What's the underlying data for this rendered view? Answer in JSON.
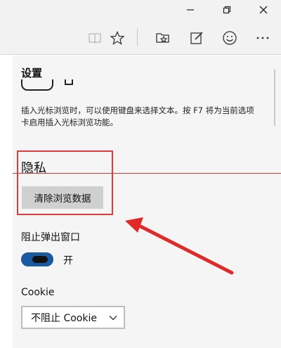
{
  "settings": {
    "title": "设置",
    "caret_browsing_desc": "插入光标浏览时，可以使用键盘来选择文本。按 F7 将为当前选项卡启用插入光标浏览功能。",
    "privacy_heading": "隐私",
    "clear_button_label": "清除浏览数据",
    "popup_label": "阻止弹出窗口",
    "popup_state": "开",
    "cookie_label": "Cookie",
    "cookie_value": "不阻止 Cookie"
  },
  "icons": {
    "toolbar": [
      "reading-view-icon",
      "favorite-star-icon",
      "hub-favorites-icon",
      "web-note-icon",
      "feedback-smiley-icon",
      "more-icon"
    ],
    "window": [
      "minimize-icon",
      "maximize-icon",
      "close-icon"
    ]
  },
  "colors": {
    "highlight_red": "#e03a3a",
    "toggle_on_blue": "#1a5aa0"
  }
}
